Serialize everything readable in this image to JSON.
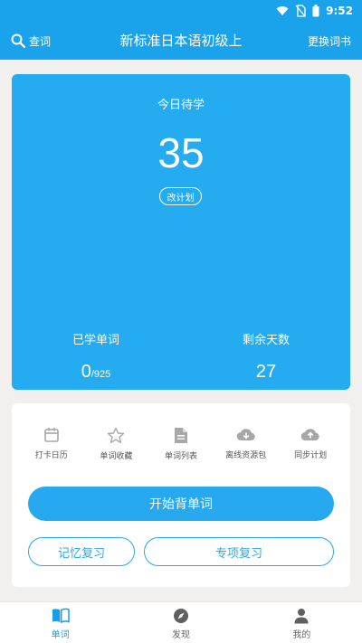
{
  "status_bar": {
    "time": "9:52",
    "icons": [
      "wifi-icon",
      "no-sim-icon",
      "battery-icon"
    ]
  },
  "header": {
    "search_label": "查词",
    "title": "新标准日本语初级上",
    "switch_label": "更换词书"
  },
  "today": {
    "label": "今日待学",
    "count": "35",
    "plan_button": "改计划"
  },
  "stats": {
    "learned_label": "已学单词",
    "learned_value": "0",
    "learned_total": "/925",
    "remaining_label": "剩余天数",
    "remaining_value": "27"
  },
  "tools": [
    {
      "icon": "calendar-icon",
      "label": "打卡日历"
    },
    {
      "icon": "star-icon",
      "label": "单词收藏"
    },
    {
      "icon": "document-icon",
      "label": "单词列表"
    },
    {
      "icon": "cloud-download-icon",
      "label": "离线资源包"
    },
    {
      "icon": "cloud-upload-icon",
      "label": "同步计划"
    }
  ],
  "actions": {
    "start": "开始背单词",
    "memory_review": "记忆复习",
    "special_review": "专项复习"
  },
  "tabs": [
    {
      "icon": "book-icon",
      "label": "单词",
      "active": true
    },
    {
      "icon": "compass-icon",
      "label": "发现",
      "active": false
    },
    {
      "icon": "person-icon",
      "label": "我的",
      "active": false
    }
  ],
  "colors": {
    "primary": "#1aa3ea",
    "card": "#25abf0",
    "background": "#f1f0ee",
    "icon_gray": "#a7a7a7"
  }
}
